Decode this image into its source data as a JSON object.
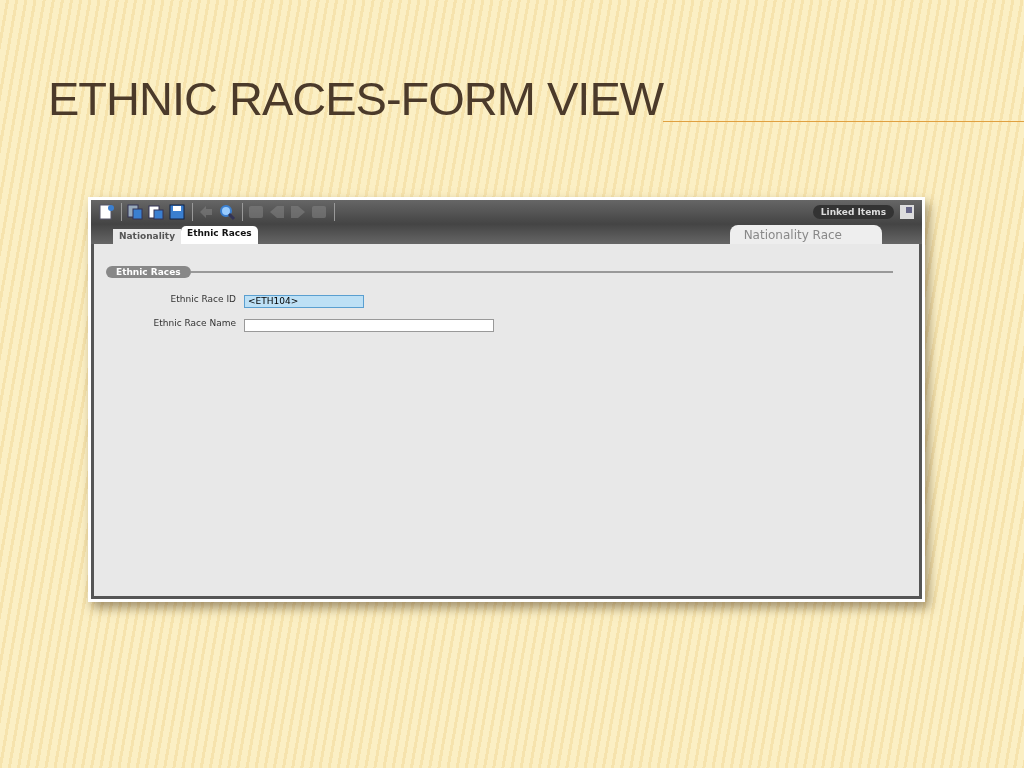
{
  "slide": {
    "title": "ETHNIC RACES-FORM VIEW"
  },
  "toolbar": {
    "groups": [
      [
        {
          "kind": "new",
          "disabled": false
        }
      ],
      [
        {
          "kind": "copy",
          "disabled": false
        },
        {
          "kind": "paste",
          "disabled": false
        },
        {
          "kind": "save",
          "disabled": false
        }
      ],
      [
        {
          "kind": "undo",
          "disabled": true
        },
        {
          "kind": "search",
          "disabled": false
        }
      ],
      [
        {
          "kind": "first",
          "disabled": true
        },
        {
          "kind": "prev",
          "disabled": true
        },
        {
          "kind": "next",
          "disabled": true
        },
        {
          "kind": "last",
          "disabled": true
        }
      ]
    ],
    "linked_items": "Linked Items"
  },
  "tabs": [
    {
      "label": "Nationality",
      "selected": false
    },
    {
      "label": "Ethnic Races",
      "selected": true
    }
  ],
  "right_tab": "Nationality Race",
  "section": "Ethnic Races",
  "fields": [
    {
      "label": "Ethnic Race ID",
      "value": "<ETH104>",
      "focused": true
    },
    {
      "label": "Ethnic Race Name",
      "focused": false
    }
  ]
}
